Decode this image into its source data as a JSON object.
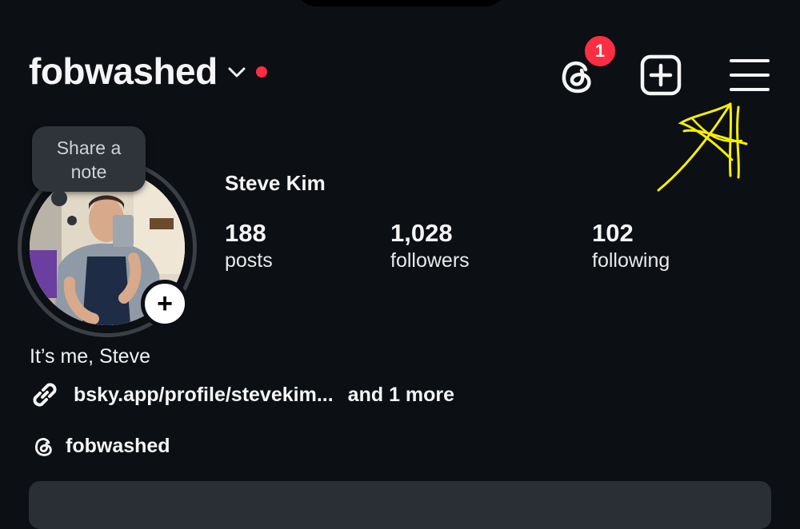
{
  "header": {
    "username": "fobwashed",
    "threads_badge_count": "1",
    "colors": {
      "badge": "#ff2d41",
      "annotation": "#f6f000"
    }
  },
  "note": {
    "text_line1": "Share a",
    "text_line2": "note"
  },
  "profile": {
    "full_name": "Steve Kim",
    "stats": [
      {
        "value": "188",
        "label": "posts"
      },
      {
        "value": "1,028",
        "label": "followers"
      },
      {
        "value": "102",
        "label": "following"
      }
    ],
    "bio": "It’s me, Steve",
    "link_text": "bsky.app/profile/stevekim...",
    "more_text": "and 1 more",
    "threads_handle": "fobwashed"
  },
  "icons": [
    "chevron-down-icon",
    "threads-icon",
    "add-square-icon",
    "menu-icon",
    "link-icon",
    "threads-small-icon",
    "plus-icon"
  ]
}
